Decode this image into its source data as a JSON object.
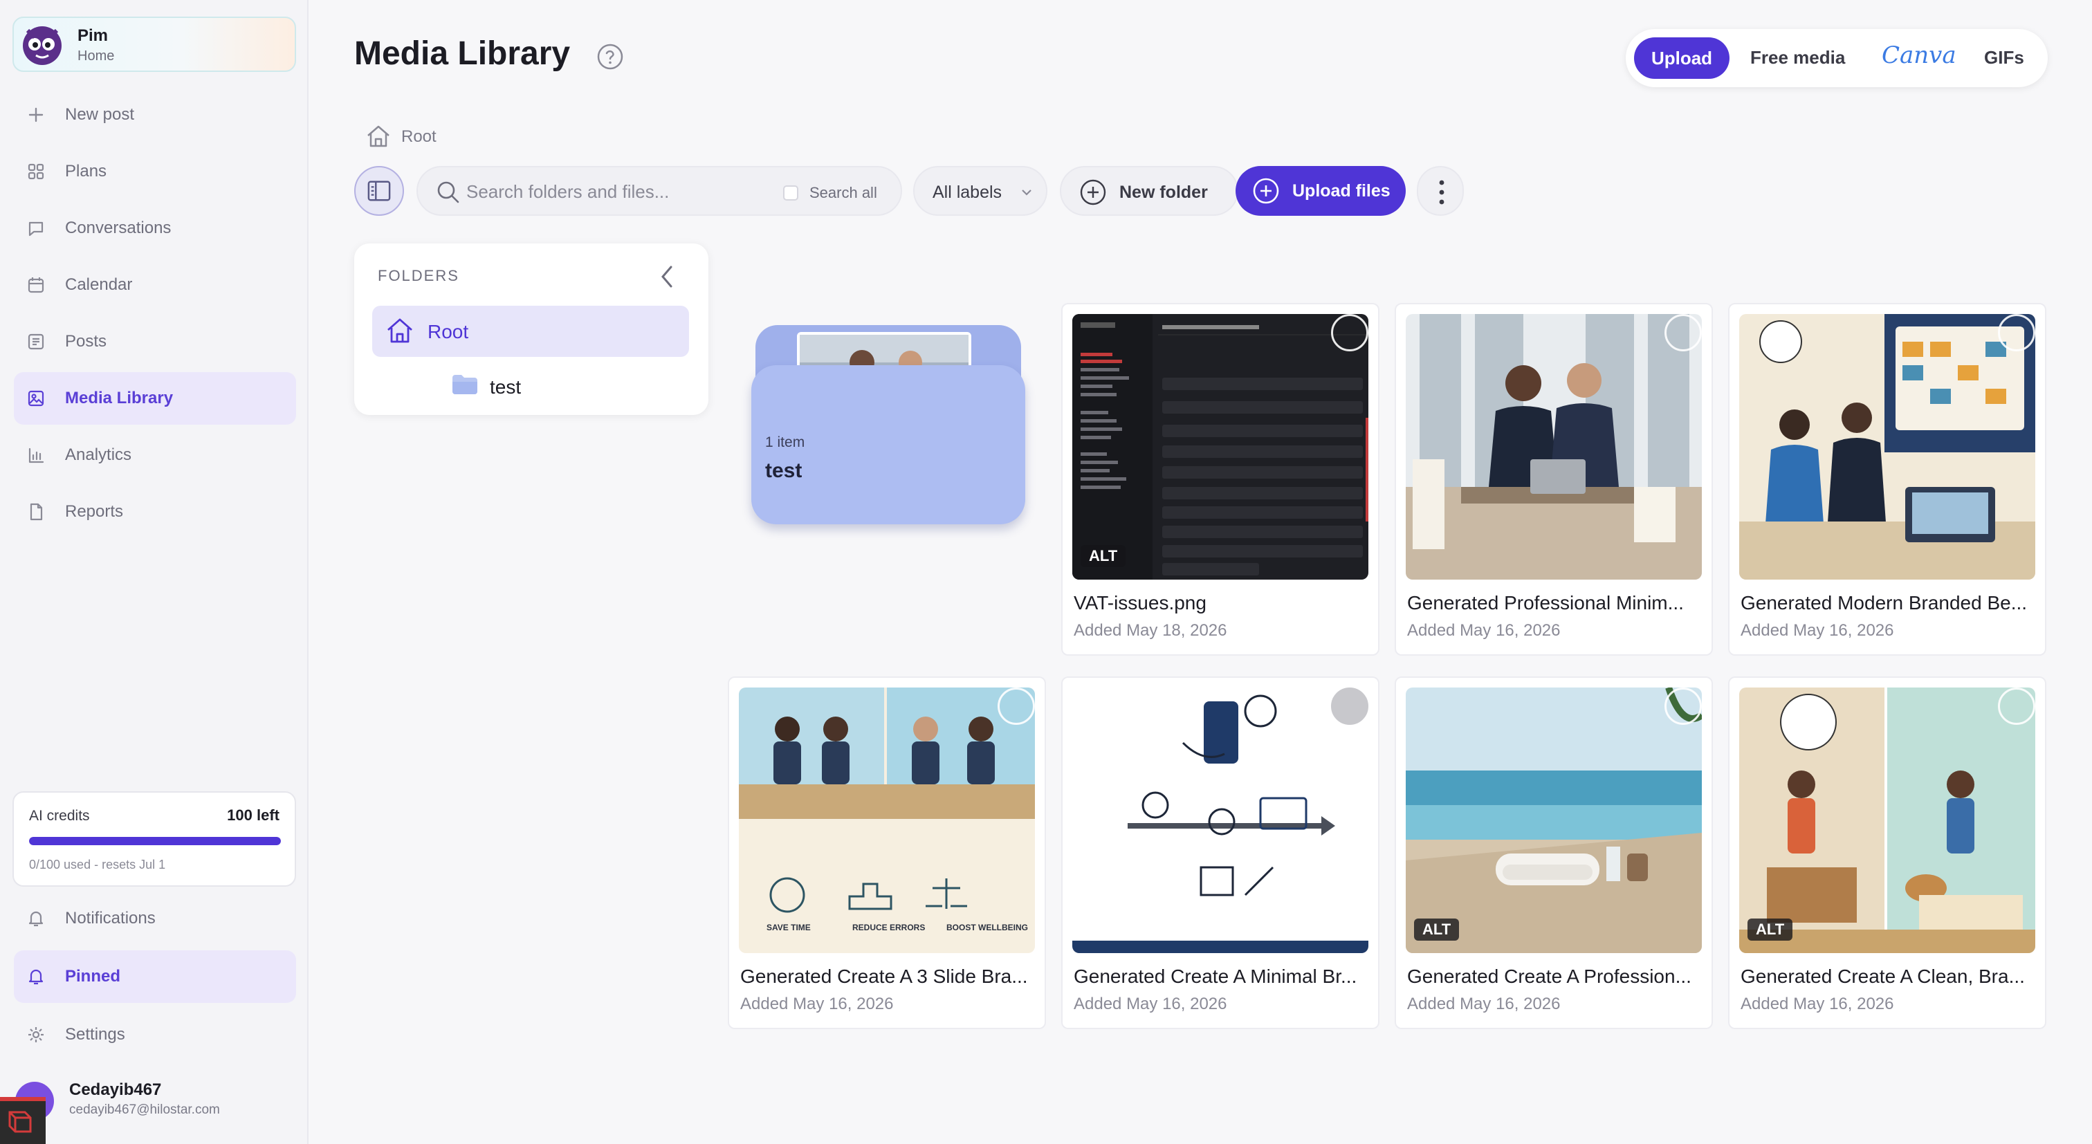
{
  "account": {
    "name": "Pim",
    "subtitle": "Home"
  },
  "sidebar": {
    "items": [
      {
        "label": "New post",
        "icon": "plus-icon"
      },
      {
        "label": "Plans",
        "icon": "grid-icon"
      },
      {
        "label": "Conversations",
        "icon": "chat-icon"
      },
      {
        "label": "Calendar",
        "icon": "calendar-icon"
      },
      {
        "label": "Posts",
        "icon": "list-icon"
      },
      {
        "label": "Media Library",
        "icon": "image-icon",
        "active": true
      },
      {
        "label": "Analytics",
        "icon": "bar-chart-icon"
      },
      {
        "label": "Reports",
        "icon": "document-icon"
      }
    ],
    "bottom_items": [
      {
        "label": "Notifications",
        "icon": "bell-icon"
      },
      {
        "label": "Pinned",
        "icon": "bell-icon",
        "active": true
      },
      {
        "label": "Settings",
        "icon": "gear-icon"
      }
    ]
  },
  "credits": {
    "label": "AI credits",
    "remaining": "100 left",
    "usage": "0/100 used - resets Jul 1",
    "fill_fraction": 1.0
  },
  "user": {
    "name": "Cedayib467",
    "email": "cedayib467@hilostar.com"
  },
  "page": {
    "title": "Media Library"
  },
  "topbar": {
    "upload": "Upload",
    "free_media": "Free media",
    "canva": "Canva",
    "gifs": "GIFs"
  },
  "breadcrumb": {
    "root": "Root"
  },
  "toolbar": {
    "search_placeholder": "Search folders and files...",
    "search_all": "Search all",
    "labels": "All labels",
    "new_folder": "New folder",
    "upload_files": "Upload files"
  },
  "folders": {
    "heading": "FOLDERS",
    "root": "Root",
    "children": [
      {
        "name": "test"
      }
    ]
  },
  "folder_card": {
    "count": "1 item",
    "name": "test"
  },
  "media": [
    {
      "name": "VAT-issues.png",
      "date": "Added May 18, 2026",
      "alt": "ALT"
    },
    {
      "name": "Generated Professional Minim...",
      "date": "Added May 16, 2026",
      "alt": ""
    },
    {
      "name": "Generated Modern Branded Be...",
      "date": "Added May 16, 2026",
      "alt": ""
    },
    {
      "name": "Generated Create A 3 Slide Bra...",
      "date": "Added May 16, 2026",
      "alt": ""
    },
    {
      "name": "Generated Create A Minimal Br...",
      "date": "Added May 16, 2026",
      "alt": ""
    },
    {
      "name": "Generated Create A Profession...",
      "date": "Added May 16, 2026",
      "alt": "ALT"
    },
    {
      "name": "Generated Create A Clean, Bra...",
      "date": "Added May 16, 2026",
      "alt": "ALT"
    }
  ],
  "thumb_texts": {
    "save_time": "SAVE TIME",
    "reduce_errors": "REDUCE ERRORS",
    "boost_wellbeing": "BOOST WELLBEING"
  },
  "colors": {
    "accent": "#4f35d6",
    "active_bg": "#ebe7fb",
    "folder": "#adbdf2"
  }
}
